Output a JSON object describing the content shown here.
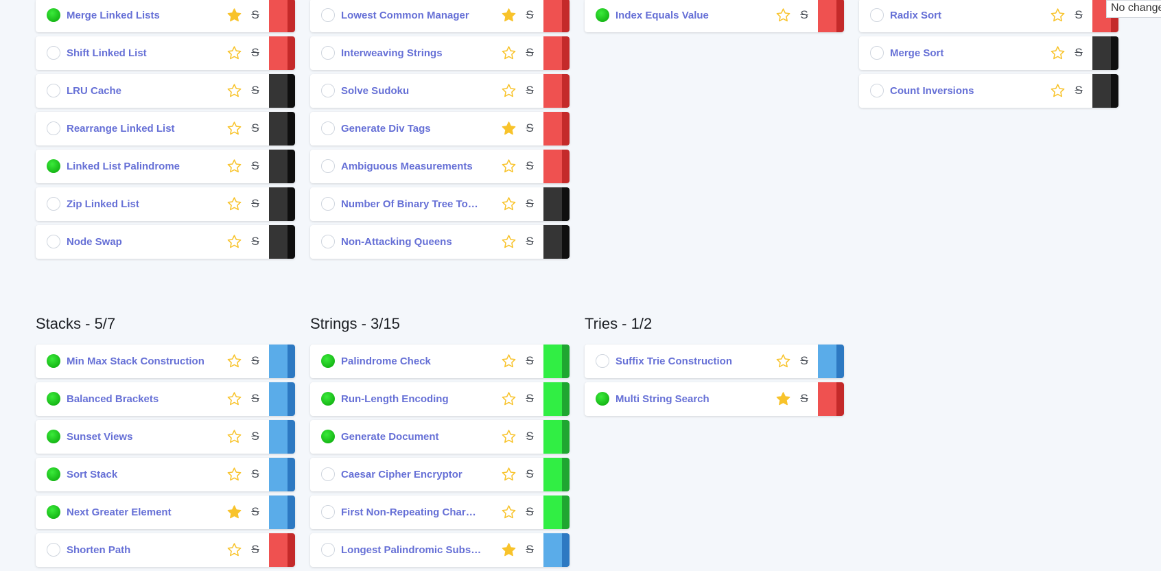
{
  "colors": {
    "title": "#6670d6",
    "completed": "#22cc22",
    "star": "#f8c32b",
    "easy": "#5aace9",
    "medium": "#31ee44",
    "hard": "#ef5150",
    "very_hard": "#353535"
  },
  "tooltip": {
    "text": "No change"
  },
  "sections": {
    "linked_lists": {
      "questions": [
        {
          "name": "Merge Linked Lists",
          "completed": true,
          "starred": true,
          "difficulty": "hard"
        },
        {
          "name": "Shift Linked List",
          "completed": false,
          "starred": false,
          "difficulty": "hard"
        },
        {
          "name": "LRU Cache",
          "completed": false,
          "starred": false,
          "difficulty": "very-hard"
        },
        {
          "name": "Rearrange Linked List",
          "completed": false,
          "starred": false,
          "difficulty": "very-hard"
        },
        {
          "name": "Linked List Palindrome",
          "completed": true,
          "starred": false,
          "difficulty": "very-hard"
        },
        {
          "name": "Zip Linked List",
          "completed": false,
          "starred": false,
          "difficulty": "very-hard"
        },
        {
          "name": "Node Swap",
          "completed": false,
          "starred": false,
          "difficulty": "very-hard"
        }
      ]
    },
    "recursion": {
      "questions": [
        {
          "name": "Lowest Common Manager",
          "completed": false,
          "starred": true,
          "difficulty": "hard"
        },
        {
          "name": "Interweaving Strings",
          "completed": false,
          "starred": false,
          "difficulty": "hard"
        },
        {
          "name": "Solve Sudoku",
          "completed": false,
          "starred": false,
          "difficulty": "hard"
        },
        {
          "name": "Generate Div Tags",
          "completed": false,
          "starred": true,
          "difficulty": "hard"
        },
        {
          "name": "Ambiguous Measurements",
          "completed": false,
          "starred": false,
          "difficulty": "hard"
        },
        {
          "name": "Number Of Binary Tree Topologies",
          "completed": false,
          "starred": false,
          "difficulty": "very-hard"
        },
        {
          "name": "Non-Attacking Queens",
          "completed": false,
          "starred": false,
          "difficulty": "very-hard"
        }
      ]
    },
    "searching": {
      "questions": [
        {
          "name": "Index Equals Value",
          "completed": true,
          "starred": false,
          "difficulty": "hard"
        }
      ]
    },
    "sorting": {
      "questions": [
        {
          "name": "Radix Sort",
          "completed": false,
          "starred": false,
          "difficulty": "hard"
        },
        {
          "name": "Merge Sort",
          "completed": false,
          "starred": false,
          "difficulty": "very-hard"
        },
        {
          "name": "Count Inversions",
          "completed": false,
          "starred": false,
          "difficulty": "very-hard"
        }
      ]
    },
    "stacks": {
      "title": "Stacks - 5/7",
      "questions": [
        {
          "name": "Min Max Stack Construction",
          "completed": true,
          "starred": false,
          "difficulty": "easy"
        },
        {
          "name": "Balanced Brackets",
          "completed": true,
          "starred": false,
          "difficulty": "easy"
        },
        {
          "name": "Sunset Views",
          "completed": true,
          "starred": false,
          "difficulty": "easy"
        },
        {
          "name": "Sort Stack",
          "completed": true,
          "starred": false,
          "difficulty": "easy"
        },
        {
          "name": "Next Greater Element",
          "completed": true,
          "starred": true,
          "difficulty": "easy"
        },
        {
          "name": "Shorten Path",
          "completed": false,
          "starred": false,
          "difficulty": "hard"
        }
      ]
    },
    "strings": {
      "title": "Strings - 3/15",
      "questions": [
        {
          "name": "Palindrome Check",
          "completed": true,
          "starred": false,
          "difficulty": "medium"
        },
        {
          "name": "Run-Length Encoding",
          "completed": true,
          "starred": false,
          "difficulty": "medium"
        },
        {
          "name": "Generate Document",
          "completed": true,
          "starred": false,
          "difficulty": "medium"
        },
        {
          "name": "Caesar Cipher Encryptor",
          "completed": false,
          "starred": false,
          "difficulty": "medium"
        },
        {
          "name": "First Non-Repeating Character",
          "completed": false,
          "starred": false,
          "difficulty": "medium"
        },
        {
          "name": "Longest Palindromic Substring",
          "completed": false,
          "starred": true,
          "difficulty": "easy"
        }
      ]
    },
    "tries": {
      "title": "Tries - 1/2",
      "questions": [
        {
          "name": "Suffix Trie Construction",
          "completed": false,
          "starred": false,
          "difficulty": "easy"
        },
        {
          "name": "Multi String Search",
          "completed": true,
          "starred": true,
          "difficulty": "hard"
        }
      ]
    }
  }
}
